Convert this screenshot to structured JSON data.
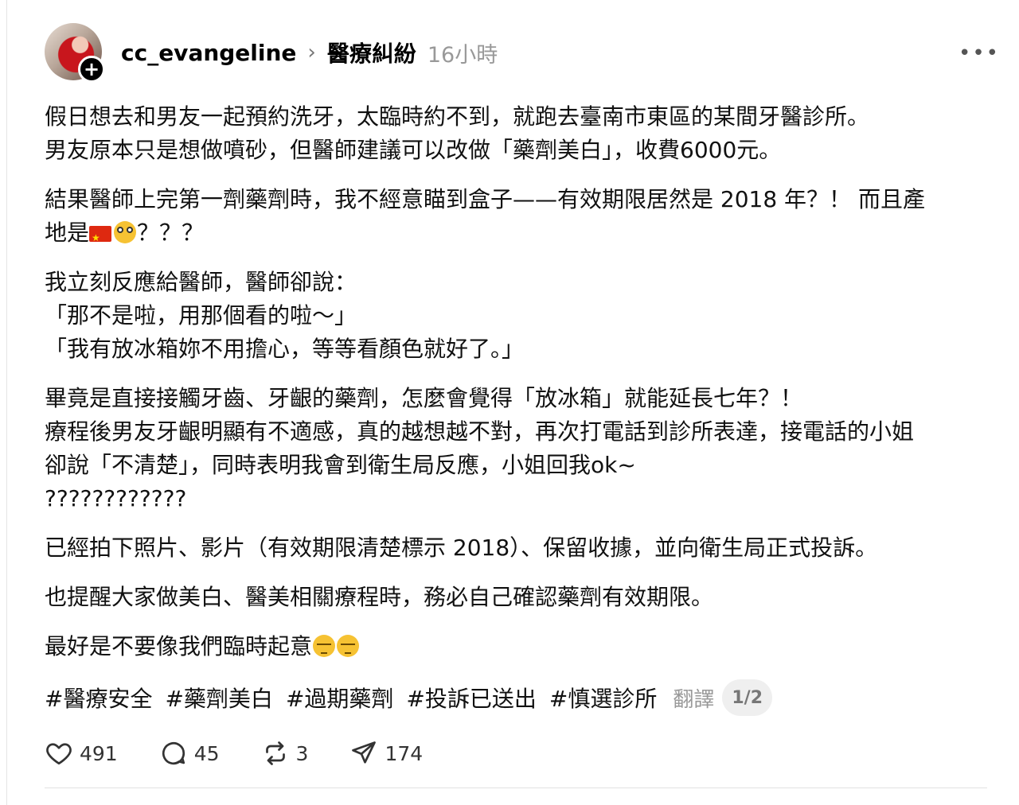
{
  "post": {
    "author": "cc_evangeline",
    "topic": "醫療糾紛",
    "time": "16小時",
    "paragraphs": [
      {
        "lines": [
          "假日想去和男友一起預約洗牙，太臨時約不到，就跑去臺南市東區的某間牙醫診所。",
          "男友原本只是想做噴砂，但醫師建議可以改做「藥劑美白」，收費6000元。"
        ]
      },
      {
        "lines": [
          "結果醫師上完第一劑藥劑時，我不經意瞄到盒子——有效期限居然是 2018 年？！ 而且產"
        ]
      },
      {
        "lines": [
          "我立刻反應給醫師，醫師卻說：",
          "「那不是啦，用那個看的啦～」",
          "「我有放冰箱妳不用擔心，等等看顏色就好了。」"
        ]
      },
      {
        "lines": [
          "畢竟是直接接觸牙齒、牙齦的藥劑，怎麼會覺得「放冰箱」就能延長七年？！",
          "療程後男友牙齦明顯有不適感，真的越想越不對，再次打電話到診所表達，接電話的小姐",
          "卻說「不清楚」，同時表明我會到衛生局反應，小姐回我ok~",
          "????????????"
        ]
      },
      {
        "lines": [
          "已經拍下照片、影片（有效期限清楚標示 2018）、保留收據，並向衛生局正式投訴。"
        ]
      },
      {
        "lines": [
          "也提醒大家做美白、醫美相關療程時，務必自己確認藥劑有效期限。"
        ]
      }
    ],
    "line_origin_prefix": "地是",
    "line_origin_suffix": "？？？",
    "last_line_text": "最好是不要像我們臨時起意",
    "tags": [
      "#醫療安全",
      "#藥劑美白",
      "#過期藥劑",
      "#投訴已送出",
      "#慎選診所"
    ],
    "translate_label": "翻譯",
    "page_indicator": "1/2"
  },
  "actions": {
    "likes": "491",
    "comments": "45",
    "reposts": "3",
    "shares": "174"
  },
  "icons": {
    "more": "more-horizontal-icon",
    "like": "heart-icon",
    "comment": "comment-bubble-icon",
    "repost": "repost-icon",
    "share": "send-icon",
    "follow": "plus-icon"
  }
}
